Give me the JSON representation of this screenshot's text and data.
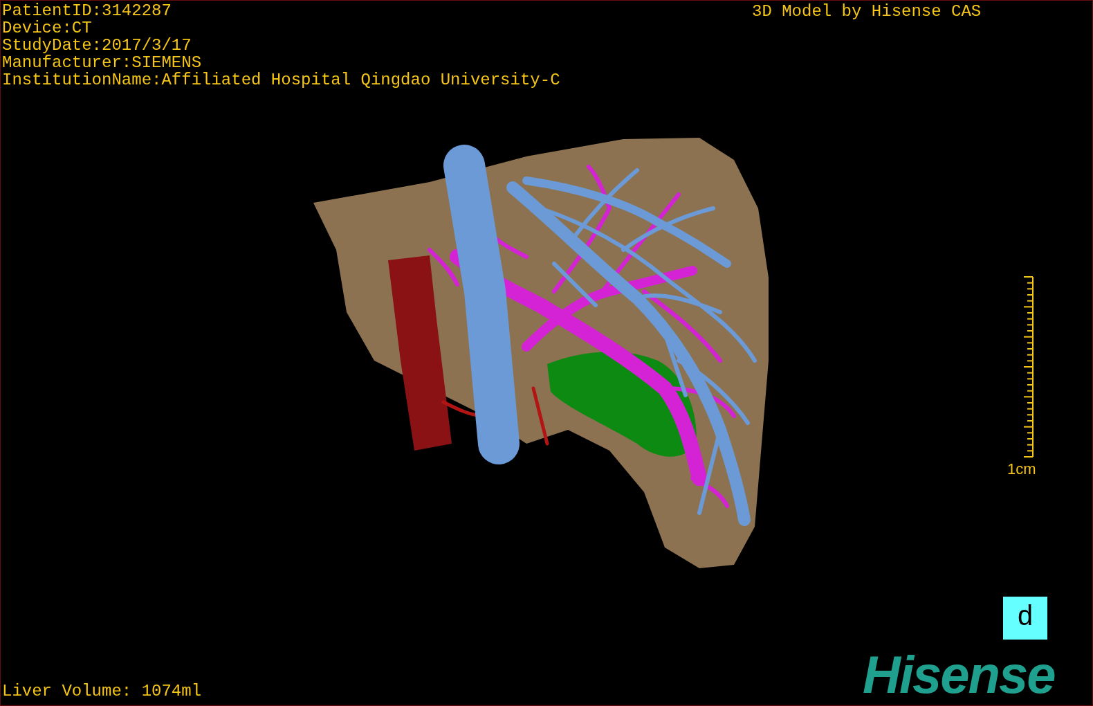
{
  "patient_info": [
    "PatientID:3142287",
    "Device:CT",
    "StudyDate:2017/3/17",
    "Manufacturer:SIEMENS",
    "InstitutionName:Affiliated Hospital Qingdao University-C"
  ],
  "title": "3D Model by Hisense CAS",
  "scale_bar": {
    "label": "1cm"
  },
  "view_button": {
    "label": "d"
  },
  "logo": {
    "text": "Hisense"
  },
  "footer": "Liver Volume: 1074ml"
}
